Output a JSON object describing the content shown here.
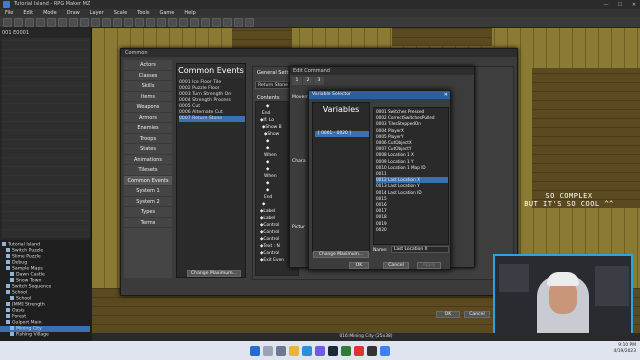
{
  "titlebar": {
    "text": "Tutorial Island - RPG Maker MZ"
  },
  "menubar": {
    "items": [
      "File",
      "Edit",
      "Mode",
      "Draw",
      "Layer",
      "Scale",
      "Tools",
      "Game",
      "Help"
    ]
  },
  "left": {
    "map_info": "001 E0001",
    "tree": [
      {
        "label": "Tutorial Island",
        "depth": 0
      },
      {
        "label": "Switch Puzzle",
        "depth": 1
      },
      {
        "label": "Slime Puzzle",
        "depth": 1
      },
      {
        "label": "Debug",
        "depth": 1
      },
      {
        "label": "Sample Maps",
        "depth": 1
      },
      {
        "label": "Dawn Castle",
        "depth": 2
      },
      {
        "label": "Snow Town",
        "depth": 2
      },
      {
        "label": "Switch Sequence",
        "depth": 1
      },
      {
        "label": "School",
        "depth": 1
      },
      {
        "label": "School",
        "depth": 2
      },
      {
        "label": "[MM] Strength",
        "depth": 1
      },
      {
        "label": "Oasis",
        "depth": 1
      },
      {
        "label": "Forest",
        "depth": 1
      },
      {
        "label": "Gulport Main",
        "depth": 1
      },
      {
        "label": "Mining City",
        "depth": 2,
        "selected": true
      },
      {
        "label": "Fishing Village",
        "depth": 2
      }
    ]
  },
  "common_events_window": {
    "title": "Common",
    "categories": [
      "Actors",
      "Classes",
      "Skills",
      "Items",
      "Weapons",
      "Armors",
      "Enemies",
      "Troops",
      "States",
      "Animations",
      "Tilesets",
      "Common Events",
      "System 1",
      "System 2",
      "Types",
      "Terms"
    ],
    "selected_category": "Common Events",
    "list_header": "Common Events",
    "events": [
      {
        "label": "0001 Ice Floor Tile"
      },
      {
        "label": "0002 Puzzle Floor"
      },
      {
        "label": "0003 Turn Strength On"
      },
      {
        "label": "0004 Strength Process"
      },
      {
        "label": "0005 Cut"
      },
      {
        "label": "0006 Alternate Cut"
      },
      {
        "label": "0007 Return Stone",
        "selected": true
      }
    ],
    "change_maximum": "Change Maximum...",
    "general_label": "General Sett",
    "name_value": "Return Stone",
    "contents_label": "Contents",
    "contents_lines": [
      "◆",
      "End",
      "◆If: Lo",
      "◆Show B",
      "◆Show",
      "◆",
      "◆",
      "When",
      "◆",
      "◆",
      "When",
      "◆",
      "◆",
      "End",
      "◆",
      "◆Label",
      "◆Label",
      "◆Control",
      "◆Control",
      "◆Control",
      "◆Text : N",
      "◆Control",
      "◆Exit Even"
    ],
    "ok": "OK",
    "cancel": "Cancel",
    "apply": "Apply"
  },
  "edit_command": {
    "title": "Edit Command",
    "tabs": [
      "1",
      "2",
      "3"
    ],
    "groups": [
      "Movem",
      "Chara",
      "Pictur"
    ]
  },
  "variable_selector": {
    "title": "Variable Selector",
    "close": "✕",
    "groups_header": "Variables",
    "selected_group": "[ 0001 - 0020 ]",
    "items": [
      {
        "label": "0001 Switches Pressed"
      },
      {
        "label": "0002 CorrectSwitchesPulled"
      },
      {
        "label": "0003 TilesSteppedOn"
      },
      {
        "label": "0004 PlayerX"
      },
      {
        "label": "0005 PlayerY"
      },
      {
        "label": "0006 CutObjectX"
      },
      {
        "label": "0007 CutObjectY"
      },
      {
        "label": "0008 Location 1 X"
      },
      {
        "label": "0009 Location 1 Y"
      },
      {
        "label": "0010 Location 1 Map ID"
      },
      {
        "label": "0011"
      },
      {
        "label": "0012 Last Location X",
        "selected": true
      },
      {
        "label": "0013 Last Location Y"
      },
      {
        "label": "0014 Last Location ID"
      },
      {
        "label": "0015"
      },
      {
        "label": "0016"
      },
      {
        "label": "0017"
      },
      {
        "label": "0018"
      },
      {
        "label": "0019"
      },
      {
        "label": "0020"
      }
    ],
    "change_maximum": "Change Maximum...",
    "name_label": "Name:",
    "name_value": "Last Location X",
    "ok": "OK",
    "cancel": "Cancel",
    "apply": "Apply"
  },
  "overlay": {
    "line1": "SO COMPLEX",
    "line2": "BUT IT'S SO COOL ^^"
  },
  "webcam": {
    "caption": "...AH - RUNTHEMIC_VNOE"
  },
  "statusbar": {
    "text": "016:Mining City (25x38)"
  },
  "tray": {
    "time": "9:10 PM",
    "date": "4/19/2023"
  }
}
